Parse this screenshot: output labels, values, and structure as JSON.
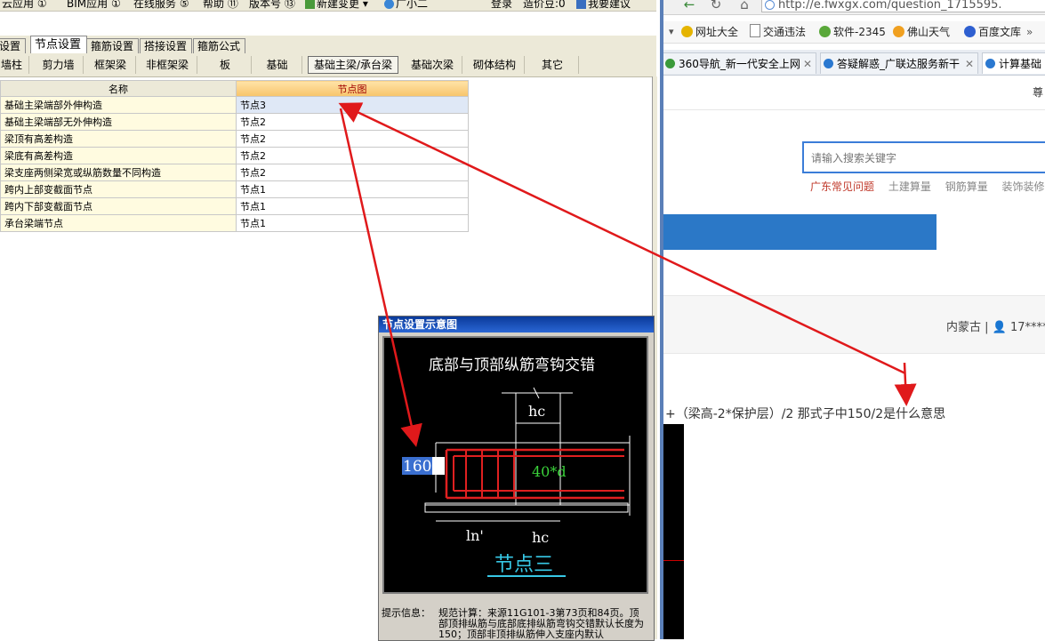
{
  "menu": {
    "items": [
      "云应用 ①",
      "BIM应用 ①",
      "在线服务 ⑤",
      "帮助 ⑪",
      "版本号 ⑬",
      "新建变更",
      "广小二",
      "登录",
      "造价豆:0",
      "我要建议"
    ]
  },
  "main_tabs": [
    "设置",
    "节点设置",
    "箍筋设置",
    "搭接设置",
    "箍筋公式"
  ],
  "sub_tabs": [
    "墙柱",
    "剪力墙",
    "框架梁",
    "非框架梁",
    "板",
    "基础",
    "基础主梁/承台梁",
    "基础次梁",
    "砌体结构",
    "其它"
  ],
  "grid": {
    "headers": [
      "名称",
      "节点图"
    ],
    "rows": [
      {
        "name": "基础主梁端部外伸构造",
        "value": "节点3"
      },
      {
        "name": "基础主梁端部无外伸构造",
        "value": "节点2"
      },
      {
        "name": "梁顶有高差构造",
        "value": "节点2"
      },
      {
        "name": "梁底有高差构造",
        "value": "节点2"
      },
      {
        "name": "梁支座两侧梁宽或纵筋数量不同构造",
        "value": "节点2"
      },
      {
        "name": "跨内上部变截面节点",
        "value": "节点1"
      },
      {
        "name": "跨内下部变截面节点",
        "value": "节点1"
      },
      {
        "name": "承台梁端节点",
        "value": "节点1"
      }
    ]
  },
  "dialog": {
    "title": "节点设置示意图",
    "diagram": {
      "heading": "底部与顶部纵筋弯钩交错",
      "hc_top": "hc",
      "hc_bottom": "hc",
      "ln": "ln'",
      "anchor": "40*d",
      "value": "160",
      "caption": "节点三"
    },
    "hint_label": "提示信息：",
    "hint_text": "规范计算：来源11G101-3第73页和84页。顶部顶排纵筋与底部底排纵筋弯钩交错默认长度为150；顶部非顶排纵筋伸入支座内默认"
  },
  "browser": {
    "url": "http://e.fwxgx.com/question_1715595.",
    "bookmarks": [
      "网址大全",
      "交通违法",
      "软件-2345",
      "佛山天气",
      "百度文库"
    ],
    "tabs": [
      "360导航_新一代安全上网",
      "答疑解惑_广联达服务新干",
      "计算基础"
    ],
    "top_cut": "尊",
    "search_placeholder": "请输入搜索关键字",
    "hot_links": [
      "广东常见问题",
      "土建算量",
      "钢筋算量",
      "装饰装修"
    ],
    "meta": "内蒙古 | 👤 17****",
    "question": "+（梁高-2*保护层）/2   那式子中150/2是什么意思"
  },
  "colors": {
    "arrow": "#e0191b",
    "rebar": "#e02020",
    "accent_blue": "#2b78c7",
    "caption": "#37c8e6"
  }
}
